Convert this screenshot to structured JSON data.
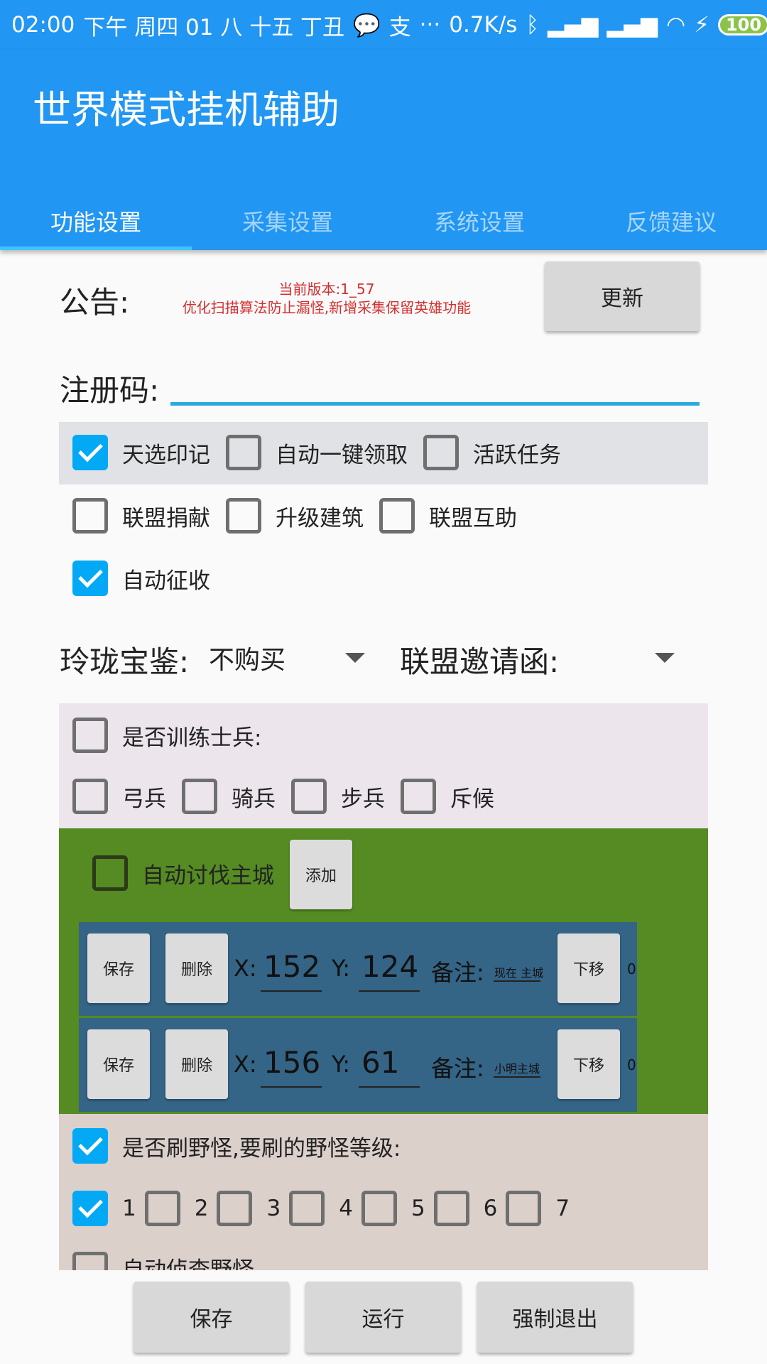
{
  "status_bar": {
    "time": "02:00",
    "date_info": "下午 周四 01 八 十五 丁丑",
    "speed": "0.7K/s",
    "battery": "100"
  },
  "app": {
    "title": "世界模式挂机辅助"
  },
  "tabs": [
    {
      "label": "功能设置",
      "active": true
    },
    {
      "label": "采集设置",
      "active": false
    },
    {
      "label": "系统设置",
      "active": false
    },
    {
      "label": "反馈建议",
      "active": false
    }
  ],
  "notice": {
    "label": "公告:",
    "version": "当前版本:1_57",
    "text": "优化扫描算法防止漏怪,新增采集保留英雄功能",
    "update_button": "更新"
  },
  "registration": {
    "label": "注册码:",
    "value": ""
  },
  "options": [
    {
      "label": "天选印记",
      "checked": true
    },
    {
      "label": "自动一键领取",
      "checked": false
    },
    {
      "label": "活跃任务",
      "checked": false
    },
    {
      "label": "联盟捐献",
      "checked": false
    },
    {
      "label": "升级建筑",
      "checked": false
    },
    {
      "label": "联盟互助",
      "checked": false
    },
    {
      "label": "自动征收",
      "checked": true
    }
  ],
  "dropdowns": {
    "treasure_label": "玲珑宝鉴:",
    "treasure_value": "不购买",
    "invite_label": "联盟邀请函:",
    "invite_value": ""
  },
  "training": {
    "label": "是否训练士兵:",
    "checked": false,
    "units": [
      {
        "label": "弓兵",
        "checked": false
      },
      {
        "label": "骑兵",
        "checked": false
      },
      {
        "label": "步兵",
        "checked": false
      },
      {
        "label": "斥候",
        "checked": false
      }
    ]
  },
  "attack": {
    "label": "自动讨伐主城",
    "checked": false,
    "add_button": "添加",
    "entries": [
      {
        "save": "保存",
        "delete": "删除",
        "x_label": "X:",
        "x": "152",
        "y_label": "Y:",
        "y": "124",
        "note_label": "备注:",
        "note": "现在 主城",
        "down": "下移",
        "index": "0"
      },
      {
        "save": "保存",
        "delete": "删除",
        "x_label": "X:",
        "x": "156",
        "y_label": "Y:",
        "y": "61",
        "note_label": "备注:",
        "note": "小明主城",
        "down": "下移",
        "index": "0"
      }
    ]
  },
  "wild": {
    "label": "是否刷野怪,要刷的野怪等级:",
    "checked": true,
    "levels": [
      {
        "label": "1",
        "checked": true
      },
      {
        "label": "2",
        "checked": false
      },
      {
        "label": "3",
        "checked": false
      },
      {
        "label": "4",
        "checked": false
      },
      {
        "label": "5",
        "checked": false
      },
      {
        "label": "6",
        "checked": false
      },
      {
        "label": "7",
        "checked": false
      }
    ],
    "scout_label": "自动侦查野怪"
  },
  "bottom": {
    "save": "保存",
    "run": "运行",
    "exit": "强制退出"
  }
}
